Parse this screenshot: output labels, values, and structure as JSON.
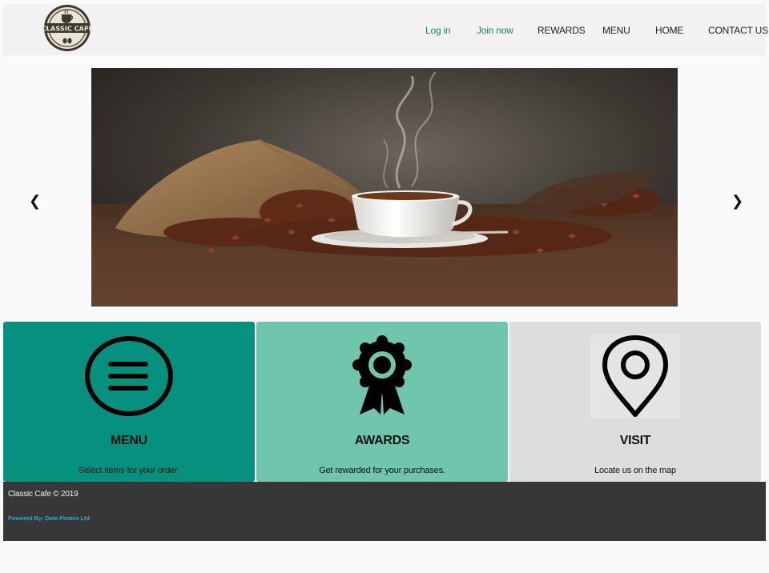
{
  "brand": {
    "logo_text": "CLASSIC CAFE",
    "logo_colors": {
      "ring": "#3d3a2e",
      "fill": "#e9e4d5"
    }
  },
  "nav": {
    "login": "Log in",
    "join": "Join now",
    "rewards": "REWARDS",
    "menu": "MENU",
    "home": "HOME",
    "contact": "CONTACT US",
    "accent_color": "#1a7f70"
  },
  "carousel": {
    "prev_glyph": "❮",
    "next_glyph": "❯"
  },
  "cards": [
    {
      "title": "MENU",
      "description": "Select items for your order.",
      "icon": "menu-circle-icon",
      "color": "#05917d"
    },
    {
      "title": "AWARDS",
      "description": "Get rewarded for your purchases.",
      "icon": "award-ribbon-icon",
      "color": "#6fc6ad"
    },
    {
      "title": "VISIT",
      "description": "Locate us on the map",
      "icon": "map-pin-icon",
      "color": "#dcdedd"
    }
  ],
  "footer": {
    "copyright": "Classic Cafe © 2019",
    "powered_by": "Powered By: Data Pirates Ltd"
  }
}
